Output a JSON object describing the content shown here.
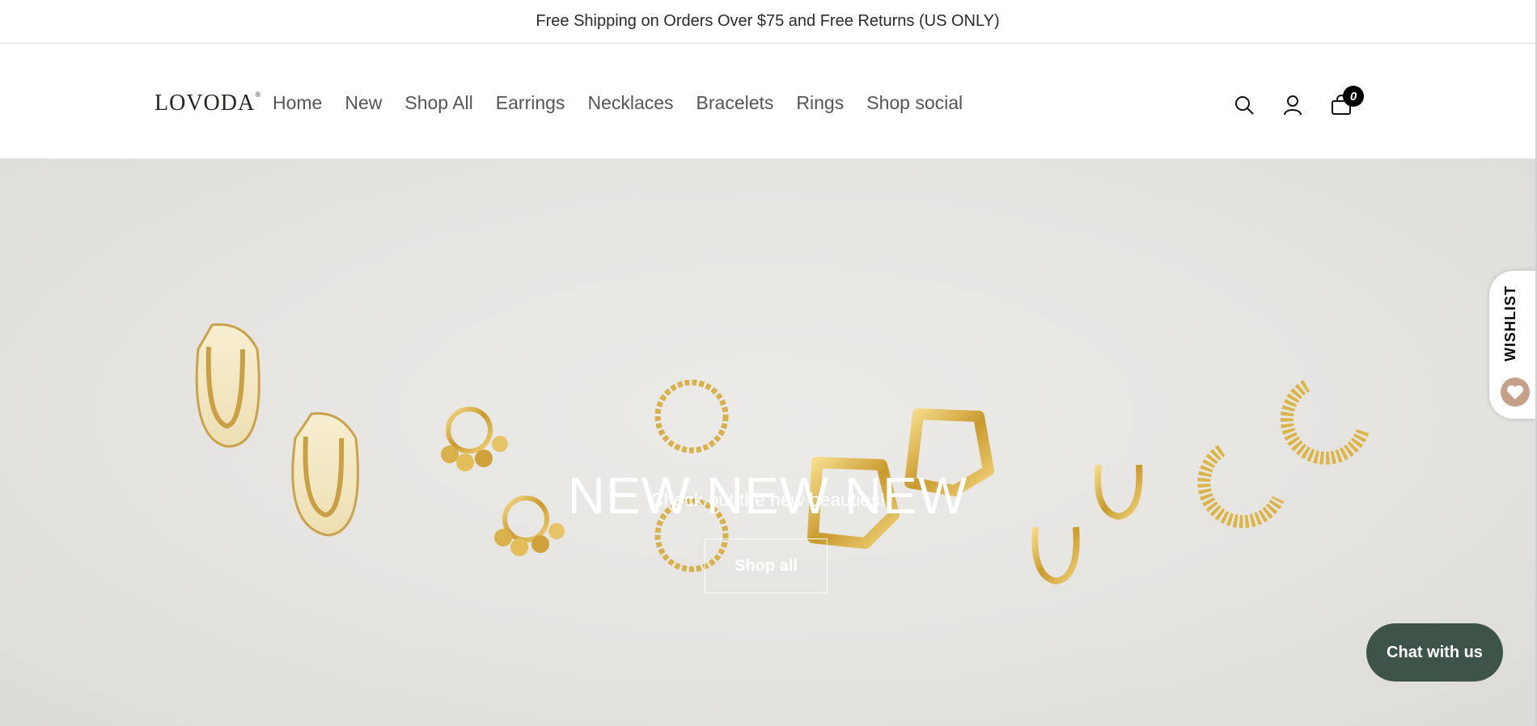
{
  "announcement": {
    "text": "Free Shipping on Orders Over $75 and Free Returns (US ONLY)"
  },
  "header": {
    "logo_text": "LOVODA",
    "logo_mark": "®",
    "nav": [
      {
        "label": "Home"
      },
      {
        "label": "New"
      },
      {
        "label": "Shop All"
      },
      {
        "label": "Earrings"
      },
      {
        "label": "Necklaces"
      },
      {
        "label": "Bracelets"
      },
      {
        "label": "Rings"
      },
      {
        "label": "Shop social"
      }
    ],
    "icons": {
      "search": "search-icon",
      "account": "account-icon",
      "cart": "bag-icon"
    },
    "cart_count": "0"
  },
  "hero": {
    "title": "NEW NEW NEW",
    "subtitle": "Check out the new beauties!",
    "button_label": "Shop all",
    "image_subject": "gold hoop earrings on light background"
  },
  "wishlist": {
    "label": "WISHLIST",
    "icon": "heart-icon"
  },
  "chat": {
    "label": "Chat with us"
  },
  "colors": {
    "chat_bg": "#3f5448",
    "wishlist_heart": "#c7a08a",
    "gold": "#d4a93a"
  }
}
